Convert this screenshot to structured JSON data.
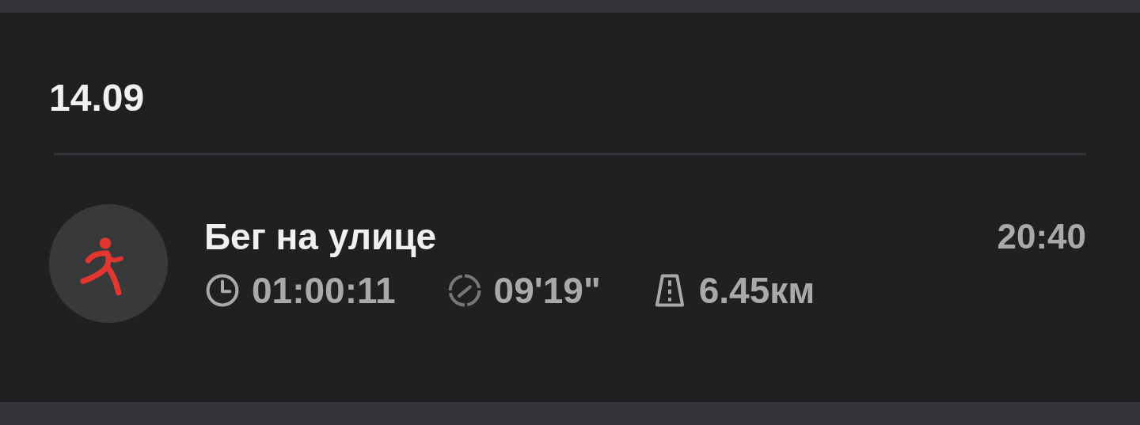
{
  "date": "14.09",
  "activity": {
    "title": "Бег на улице",
    "time": "20:40",
    "stats": [
      {
        "kind": "duration",
        "value": "01:00:11"
      },
      {
        "kind": "pace",
        "value": "09'19\""
      },
      {
        "kind": "distance",
        "value": "6.45км"
      }
    ]
  }
}
